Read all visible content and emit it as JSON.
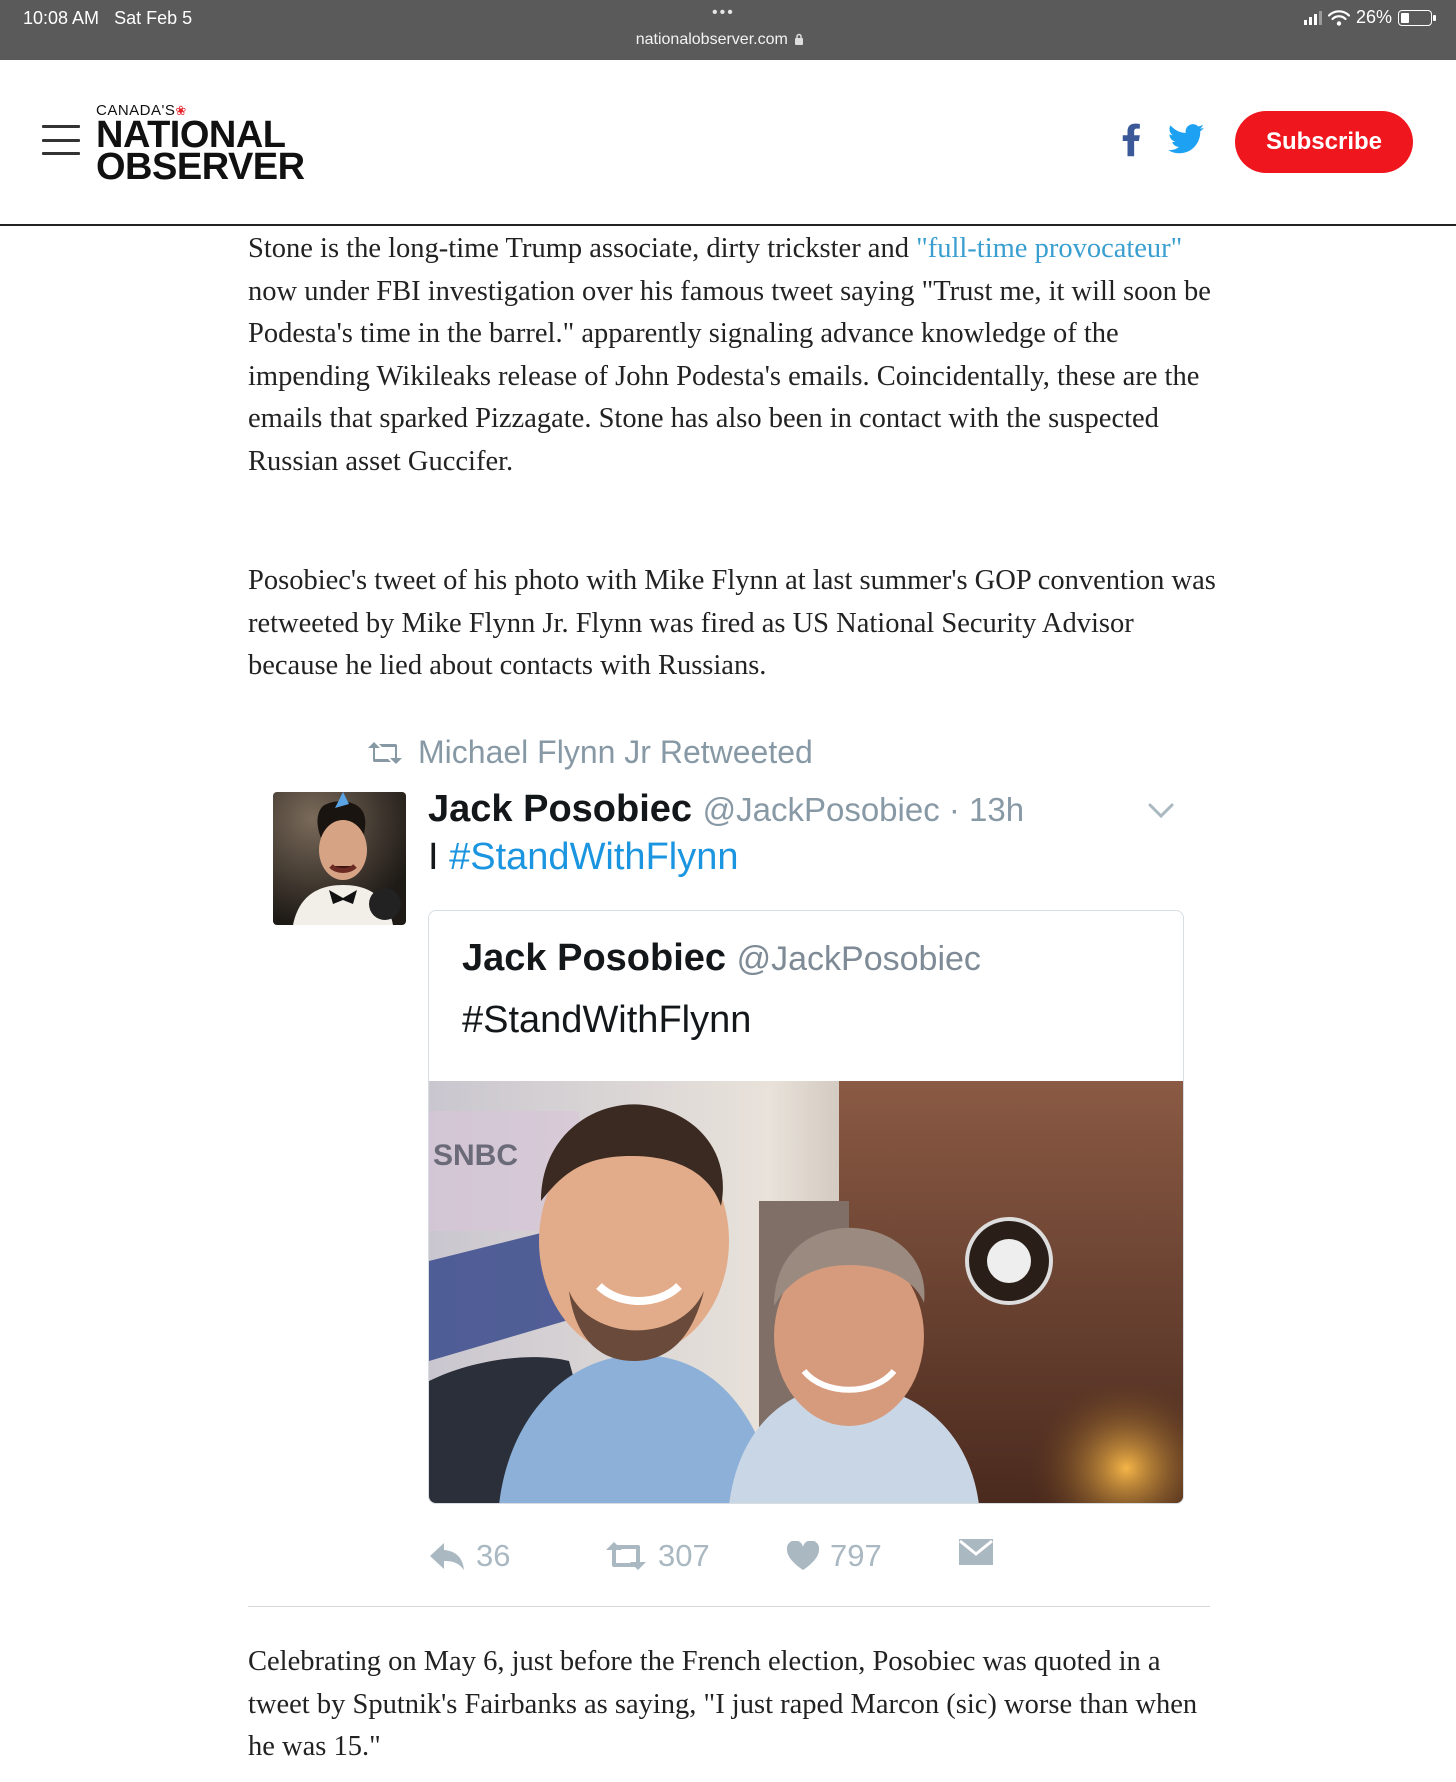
{
  "status_bar": {
    "time": "10:08 AM",
    "date": "Sat Feb 5",
    "dots": "•••",
    "url": "nationalobserver.com",
    "battery": "26%"
  },
  "header": {
    "logo_small": "CANADA'S",
    "logo_line1": "NATIONAL",
    "logo_line2": "OBSERVER",
    "subscribe_label": "Subscribe"
  },
  "article": {
    "p1_a": "Stone is the long-time Trump associate, dirty trickster and ",
    "p1_link": "\"full-time provocateur\"",
    "p1_b": " now under FBI investigation over his famous tweet saying \"Trust me, it will soon be Podesta's time in the barrel.\" apparently signaling advance knowledge of the impending Wikileaks release of John Podesta's emails. Coincidentally, these are the emails that sparked Pizzagate. Stone has also been in contact with the suspected Russian asset Guccifer.",
    "p2": "Posobiec's tweet of his photo with Mike Flynn at last summer's GOP convention was retweeted by Mike Flynn Jr. Flynn was fired as US National Security Advisor because he lied about contacts with Russians.",
    "p3": "Celebrating on May 6, just before the French election, Posobiec was quoted in a tweet by Sputnik's Fairbanks as saying, \"I just raped Marcon (sic) worse than when he was 15.\""
  },
  "tweet": {
    "retweeted_by": "Michael Flynn Jr Retweeted",
    "author_name": "Jack Posobiec",
    "author_handle": "@JackPosobiec · 13h",
    "text_prefix": "I ",
    "text_hashtag": "#StandWithFlynn",
    "quote_name": "Jack Posobiec",
    "quote_handle": "@JackPosobiec",
    "quote_text": "#StandWithFlynn",
    "photo_sign": "SNBC",
    "replies": "36",
    "retweets": "307",
    "likes": "797"
  },
  "colors": {
    "subscribe_bg": "#f0161e",
    "link": "#3a9fd0",
    "twitter_blue": "#1b95e0",
    "tweet_gray": "#8899a6",
    "facebook": "#3b5998"
  },
  "icons": [
    "menu-icon",
    "facebook-icon",
    "twitter-icon",
    "retweet-icon",
    "chevron-down-icon",
    "reply-icon",
    "heart-icon",
    "mail-icon",
    "wifi-icon",
    "battery-icon",
    "maple-leaf-icon"
  ]
}
